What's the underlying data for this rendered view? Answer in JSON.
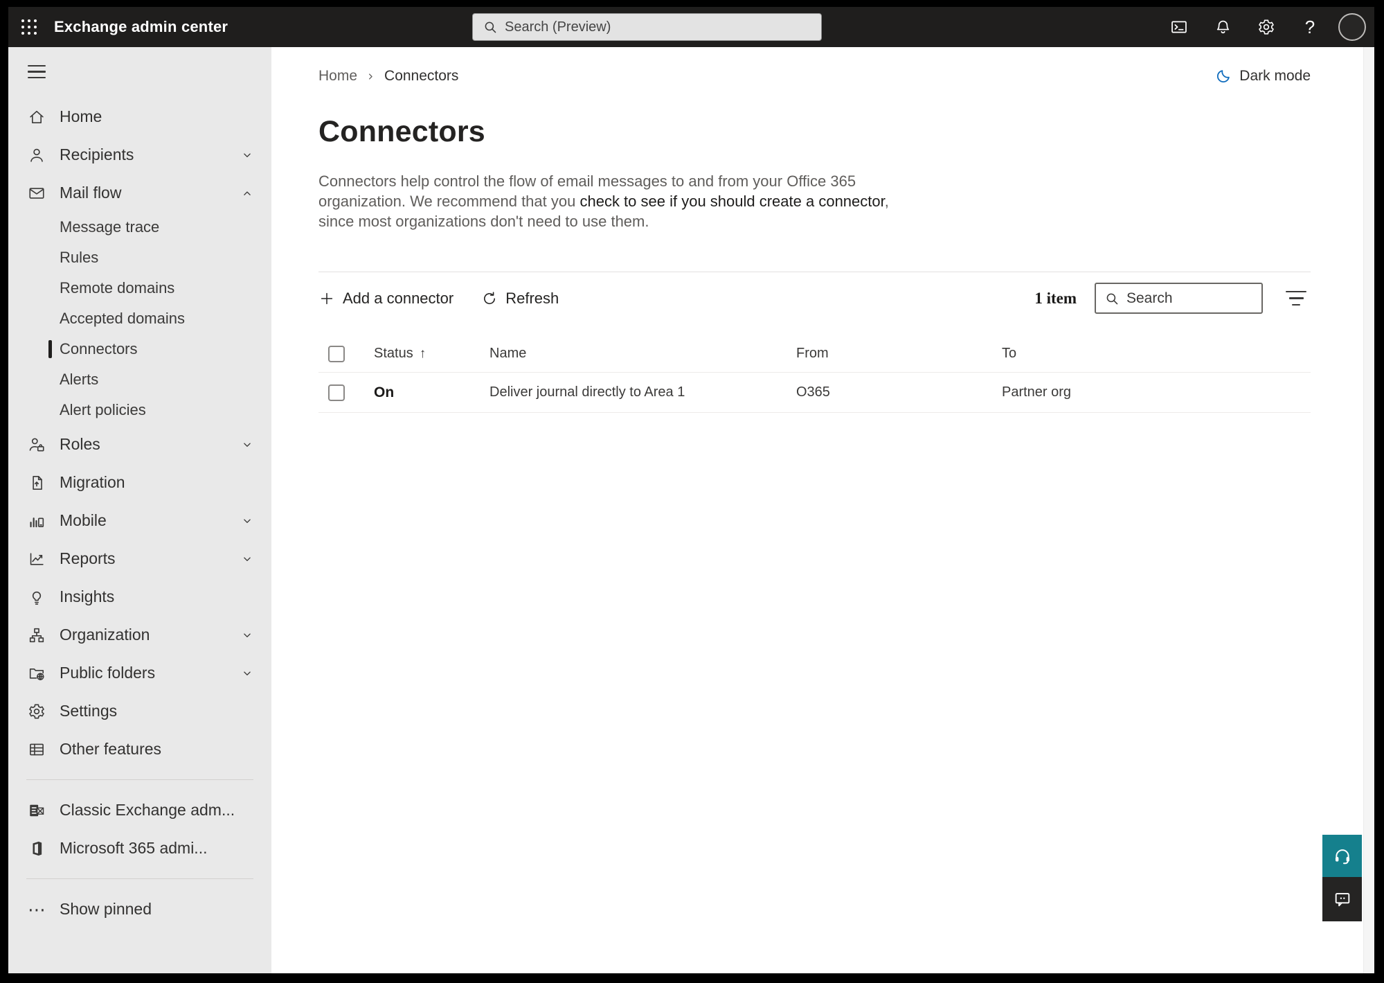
{
  "topbar": {
    "title": "Exchange admin center",
    "search_placeholder": "Search (Preview)"
  },
  "icons": {
    "help": "?",
    "show_pinned": "⋯",
    "sort_asc": "↑"
  },
  "breadcrumb": {
    "home": "Home",
    "current": "Connectors"
  },
  "dark_mode": {
    "label": "Dark mode"
  },
  "page": {
    "title": "Connectors",
    "description": {
      "pre": "Connectors help control the flow of email messages to and from your Office 365 organization. We recommend that you ",
      "link": "check to see if you should create a connector",
      "post": ", since most organizations don't need to use them."
    }
  },
  "toolbar": {
    "add_label": "Add a connector",
    "refresh_label": "Refresh",
    "item_count": "1 item",
    "search_placeholder": "Search"
  },
  "table": {
    "headers": {
      "status": "Status",
      "name": "Name",
      "from": "From",
      "to": "To"
    },
    "rows": [
      {
        "status": "On",
        "name": "Deliver journal directly to Area 1",
        "from": "O365",
        "to": "Partner org"
      }
    ]
  },
  "sidebar": {
    "items": [
      {
        "label": "Home"
      },
      {
        "label": "Recipients"
      },
      {
        "label": "Mail flow"
      },
      {
        "label": "Message trace"
      },
      {
        "label": "Rules"
      },
      {
        "label": "Remote domains"
      },
      {
        "label": "Accepted domains"
      },
      {
        "label": "Connectors"
      },
      {
        "label": "Alerts"
      },
      {
        "label": "Alert policies"
      },
      {
        "label": "Roles"
      },
      {
        "label": "Migration"
      },
      {
        "label": "Mobile"
      },
      {
        "label": "Reports"
      },
      {
        "label": "Insights"
      },
      {
        "label": "Organization"
      },
      {
        "label": "Public folders"
      },
      {
        "label": "Settings"
      },
      {
        "label": "Other features"
      },
      {
        "label": "Classic Exchange adm..."
      },
      {
        "label": "Microsoft 365 admi..."
      },
      {
        "label": "Show pinned"
      }
    ]
  },
  "colors": {
    "topbar_bg": "#1f1e1d",
    "sidebar_bg": "#e9e9e9",
    "accent_teal": "#15808d",
    "moon_blue": "#0f6cbd",
    "text_dark": "#323130",
    "text_gray": "#605e5c"
  }
}
